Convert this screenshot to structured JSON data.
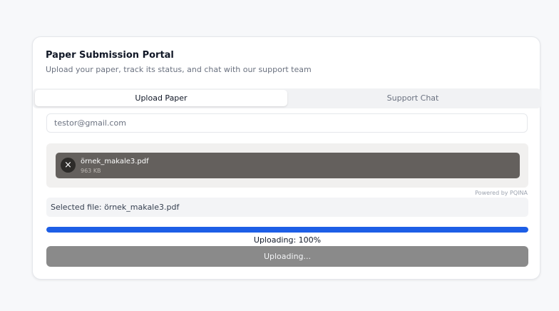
{
  "header": {
    "title": "Paper Submission Portal",
    "subtitle": "Upload your paper, track its status, and chat with our support team"
  },
  "tabs": [
    {
      "label": "Upload Paper",
      "active": true
    },
    {
      "label": "Support Chat",
      "active": false
    }
  ],
  "form": {
    "email_value": "testor@gmail.com",
    "file": {
      "name": "örnek_makale3.pdf",
      "size": "963 KB",
      "remove_icon": "close-icon"
    },
    "powered_by": "Powered by PQINA",
    "selected_file_text": "Selected file: örnek_makale3.pdf",
    "progress": {
      "percent": 100,
      "text": "Uploading: 100%"
    },
    "submit_label": "Uploading..."
  },
  "colors": {
    "accent": "#1d5ee6",
    "file_item_bg": "#64605d",
    "button_disabled": "#8a8a8a"
  }
}
